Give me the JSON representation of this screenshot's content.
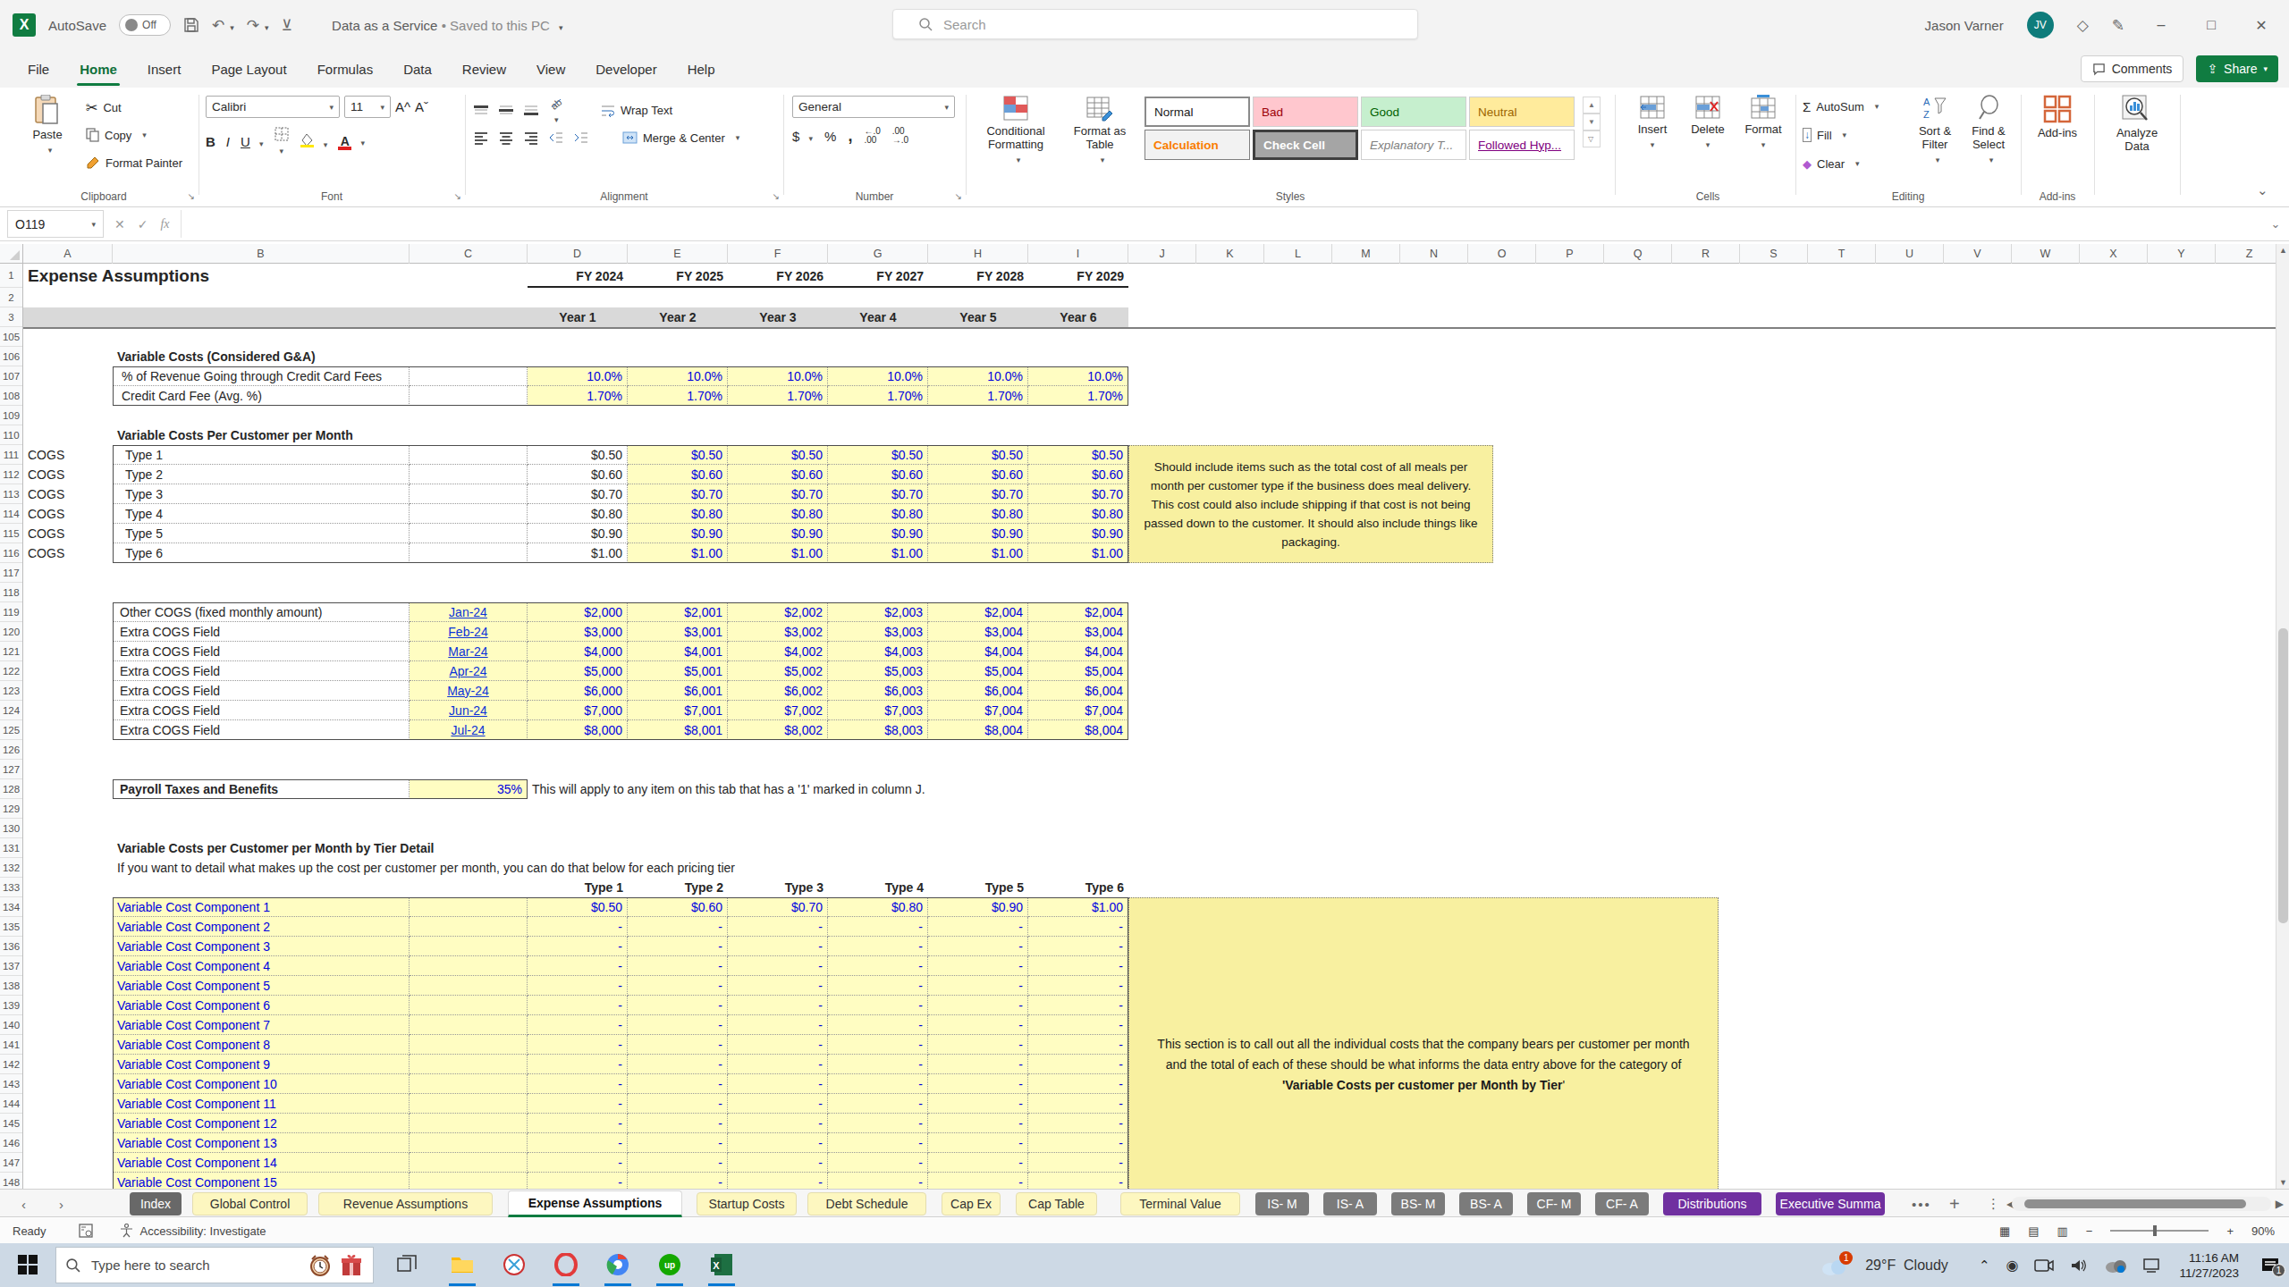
{
  "titlebar": {
    "autosave": "AutoSave",
    "autosave_state": "Off",
    "doc_title": "Data as a Service",
    "doc_status": "Saved to this PC",
    "search_placeholder": "Search",
    "user_name": "Jason Varner",
    "user_initials": "JV"
  },
  "ribbon_tabs": [
    {
      "label": "File"
    },
    {
      "label": "Home",
      "active": true
    },
    {
      "label": "Insert"
    },
    {
      "label": "Page Layout"
    },
    {
      "label": "Formulas"
    },
    {
      "label": "Data"
    },
    {
      "label": "Review"
    },
    {
      "label": "View"
    },
    {
      "label": "Developer"
    },
    {
      "label": "Help"
    }
  ],
  "tabrow_right": {
    "comments": "Comments",
    "share": "Share"
  },
  "ribbon": {
    "clipboard": {
      "paste": "Paste",
      "cut": "Cut",
      "copy": "Copy",
      "format_painter": "Format Painter",
      "label": "Clipboard"
    },
    "font": {
      "name": "Calibri",
      "size": "11",
      "label": "Font"
    },
    "alignment": {
      "wrap": "Wrap Text",
      "merge": "Merge & Center",
      "label": "Alignment"
    },
    "number": {
      "format": "General",
      "label": "Number"
    },
    "styles": {
      "cond1": "Conditional",
      "cond2": "Formatting",
      "fmt1": "Format as",
      "fmt2": "Table",
      "label": "Styles",
      "gallery": [
        {
          "label": "Normal",
          "bg": "#ffffff",
          "color": "#1a1a1a",
          "border": "2px solid #8a8a8a"
        },
        {
          "label": "Bad",
          "bg": "#ffc7ce",
          "color": "#9c0006"
        },
        {
          "label": "Good",
          "bg": "#c6efce",
          "color": "#006100"
        },
        {
          "label": "Neutral",
          "bg": "#ffeb9c",
          "color": "#9c6500"
        },
        {
          "label": "Calculation",
          "bg": "#f2f2f2",
          "color": "#fa7d00",
          "border": "1px solid #7f7f7f",
          "bold": true
        },
        {
          "label": "Check Cell",
          "bg": "#a5a5a5",
          "color": "#ffffff",
          "border": "3px solid #3f3f3f",
          "bold": true
        },
        {
          "label": "Explanatory T...",
          "bg": "#ffffff",
          "color": "#7f7f7f",
          "italic": true
        },
        {
          "label": "Followed Hyp...",
          "bg": "#ffffff",
          "color": "#800080",
          "underline": true
        }
      ]
    },
    "cells": {
      "insert": "Insert",
      "del": "Delete",
      "format": "Format",
      "label": "Cells"
    },
    "editing": {
      "autosum": "AutoSum",
      "fill": "Fill",
      "clear": "Clear",
      "sort1": "Sort &",
      "sort2": "Filter",
      "find1": "Find &",
      "find2": "Select",
      "label": "Editing"
    },
    "addins": {
      "addins": "Add-ins",
      "label": "Add-ins",
      "analyze1": "Analyze",
      "analyze2": "Data"
    }
  },
  "formula_bar": {
    "name_box": "O119",
    "fx": "fx"
  },
  "sheet": {
    "title": "Expense Assumptions",
    "fy_headers": [
      "FY 2024",
      "FY 2025",
      "FY 2026",
      "FY 2027",
      "FY 2028",
      "FY 2029"
    ],
    "year_headers": [
      "Year 1",
      "Year 2",
      "Year 3",
      "Year 4",
      "Year 5",
      "Year 6"
    ],
    "ga_heading": "Variable Costs (Considered G&A)",
    "ga_rows": [
      {
        "label": "% of Revenue Going through Credit Card Fees",
        "values": [
          "10.0%",
          "10.0%",
          "10.0%",
          "10.0%",
          "10.0%",
          "10.0%"
        ]
      },
      {
        "label": "Credit Card Fee (Avg. %)",
        "values": [
          "1.70%",
          "1.70%",
          "1.70%",
          "1.70%",
          "1.70%",
          "1.70%"
        ]
      }
    ],
    "pc_heading": "Variable Costs Per Customer per Month",
    "pc_rows": [
      {
        "tag": "COGS",
        "label": "Type 1",
        "first": "$0.50",
        "values": [
          "$0.50",
          "$0.50",
          "$0.50",
          "$0.50",
          "$0.50"
        ]
      },
      {
        "tag": "COGS",
        "label": "Type 2",
        "first": "$0.60",
        "values": [
          "$0.60",
          "$0.60",
          "$0.60",
          "$0.60",
          "$0.60"
        ]
      },
      {
        "tag": "COGS",
        "label": "Type 3",
        "first": "$0.70",
        "values": [
          "$0.70",
          "$0.70",
          "$0.70",
          "$0.70",
          "$0.70"
        ]
      },
      {
        "tag": "COGS",
        "label": "Type 4",
        "first": "$0.80",
        "values": [
          "$0.80",
          "$0.80",
          "$0.80",
          "$0.80",
          "$0.80"
        ]
      },
      {
        "tag": "COGS",
        "label": "Type 5",
        "first": "$0.90",
        "values": [
          "$0.90",
          "$0.90",
          "$0.90",
          "$0.90",
          "$0.90"
        ]
      },
      {
        "tag": "COGS",
        "label": "Type 6",
        "first": "$1.00",
        "values": [
          "$1.00",
          "$1.00",
          "$1.00",
          "$1.00",
          "$1.00"
        ]
      }
    ],
    "pc_note": "Should include items such as the total cost of all meals per month per customer type if the business does meal delivery. This cost could also include shipping if that cost is not being passed down to the customer. It should also include things like packaging.",
    "oc_rows": [
      {
        "label": "Other COGS (fixed monthly amount)",
        "date": "Jan-24",
        "values": [
          "$2,000",
          "$2,001",
          "$2,002",
          "$2,003",
          "$2,004",
          "$2,004"
        ]
      },
      {
        "label": "Extra COGS Field",
        "date": "Feb-24",
        "values": [
          "$3,000",
          "$3,001",
          "$3,002",
          "$3,003",
          "$3,004",
          "$3,004"
        ]
      },
      {
        "label": "Extra COGS Field",
        "date": "Mar-24",
        "values": [
          "$4,000",
          "$4,001",
          "$4,002",
          "$4,003",
          "$4,004",
          "$4,004"
        ]
      },
      {
        "label": "Extra COGS Field",
        "date": "Apr-24",
        "values": [
          "$5,000",
          "$5,001",
          "$5,002",
          "$5,003",
          "$5,004",
          "$5,004"
        ]
      },
      {
        "label": "Extra COGS Field",
        "date": "May-24",
        "values": [
          "$6,000",
          "$6,001",
          "$6,002",
          "$6,003",
          "$6,004",
          "$6,004"
        ]
      },
      {
        "label": "Extra COGS Field",
        "date": "Jun-24",
        "values": [
          "$7,000",
          "$7,001",
          "$7,002",
          "$7,003",
          "$7,004",
          "$7,004"
        ]
      },
      {
        "label": "Extra COGS Field",
        "date": "Jul-24",
        "values": [
          "$8,000",
          "$8,001",
          "$8,002",
          "$8,003",
          "$8,004",
          "$8,004"
        ]
      }
    ],
    "payroll": {
      "label": "Payroll Taxes and Benefits",
      "value": "35%",
      "note": "This will apply to any item on this tab that has a '1' marked in column J."
    },
    "tier_heading": "Variable Costs per Customer per Month by Tier Detail",
    "tier_desc": "If you want to detail what makes up the cost per customer per month, you can do that  below for each pricing tier",
    "type_headers": [
      "Type 1",
      "Type 2",
      "Type 3",
      "Type 4",
      "Type 5",
      "Type 6"
    ],
    "tier_rows": [
      {
        "label": "Variable Cost Component 1",
        "values": [
          "$0.50",
          "$0.60",
          "$0.70",
          "$0.80",
          "$0.90",
          "$1.00"
        ]
      },
      {
        "label": "Variable Cost Component 2",
        "values": [
          "-",
          "-",
          "-",
          "-",
          "-",
          "-"
        ]
      },
      {
        "label": "Variable Cost Component 3",
        "values": [
          "-",
          "-",
          "-",
          "-",
          "-",
          "-"
        ]
      },
      {
        "label": "Variable Cost Component 4",
        "values": [
          "-",
          "-",
          "-",
          "-",
          "-",
          "-"
        ]
      },
      {
        "label": "Variable Cost Component 5",
        "values": [
          "-",
          "-",
          "-",
          "-",
          "-",
          "-"
        ]
      },
      {
        "label": "Variable Cost Component 6",
        "values": [
          "-",
          "-",
          "-",
          "-",
          "-",
          "-"
        ]
      },
      {
        "label": "Variable Cost Component 7",
        "values": [
          "-",
          "-",
          "-",
          "-",
          "-",
          "-"
        ]
      },
      {
        "label": "Variable Cost Component 8",
        "values": [
          "-",
          "-",
          "-",
          "-",
          "-",
          "-"
        ]
      },
      {
        "label": "Variable Cost Component 9",
        "values": [
          "-",
          "-",
          "-",
          "-",
          "-",
          "-"
        ]
      },
      {
        "label": "Variable Cost Component 10",
        "values": [
          "-",
          "-",
          "-",
          "-",
          "-",
          "-"
        ]
      },
      {
        "label": "Variable Cost Component 11",
        "values": [
          "-",
          "-",
          "-",
          "-",
          "-",
          "-"
        ]
      },
      {
        "label": "Variable Cost Component 12",
        "values": [
          "-",
          "-",
          "-",
          "-",
          "-",
          "-"
        ]
      },
      {
        "label": "Variable Cost Component 13",
        "values": [
          "-",
          "-",
          "-",
          "-",
          "-",
          "-"
        ]
      },
      {
        "label": "Variable Cost Component 14",
        "values": [
          "-",
          "-",
          "-",
          "-",
          "-",
          "-"
        ]
      },
      {
        "label": "Variable Cost Component 15",
        "values": [
          "-",
          "-",
          "-",
          "-",
          "-",
          "-"
        ]
      }
    ],
    "tier_note_pre": "This section is to call out all the individual costs that the company bears per customer per month and the total of each of these should be what informs the data entry above for the category of ",
    "tier_note_bold": "'Variable Costs per customer per Month by Tier",
    "tier_note_post": "'"
  },
  "sheet_tabs": [
    {
      "label": "Index",
      "type": "dark"
    },
    {
      "label": "Global Control",
      "type": "yellow"
    },
    {
      "label": "Revenue Assumptions",
      "type": "yellow"
    },
    {
      "label": "Expense Assumptions",
      "type": "active"
    },
    {
      "label": "Startup Costs",
      "type": "yellow"
    },
    {
      "label": "Debt Schedule",
      "type": "yellow"
    },
    {
      "label": "Cap Ex",
      "type": "yellow"
    },
    {
      "label": "Cap Table",
      "type": "yellow"
    },
    {
      "label": "Terminal Value",
      "type": "yellow"
    },
    {
      "label": "IS- M",
      "type": "gray"
    },
    {
      "label": "IS- A",
      "type": "gray"
    },
    {
      "label": "BS- M",
      "type": "gray"
    },
    {
      "label": "BS- A",
      "type": "gray"
    },
    {
      "label": "CF- M",
      "type": "gray"
    },
    {
      "label": "CF- A",
      "type": "gray"
    },
    {
      "label": "Distributions",
      "type": "purple"
    },
    {
      "label": "Executive Summa",
      "type": "purple"
    }
  ],
  "status_bar": {
    "ready": "Ready",
    "accessibility": "Accessibility: Investigate",
    "zoom": "90%"
  },
  "taskbar": {
    "search_placeholder": "Type here to search",
    "weather_temp": "29°F",
    "weather_cond": "Cloudy",
    "time": "11:16 AM",
    "date": "11/27/2023",
    "notif_count": "1",
    "weather_badge": "1"
  }
}
